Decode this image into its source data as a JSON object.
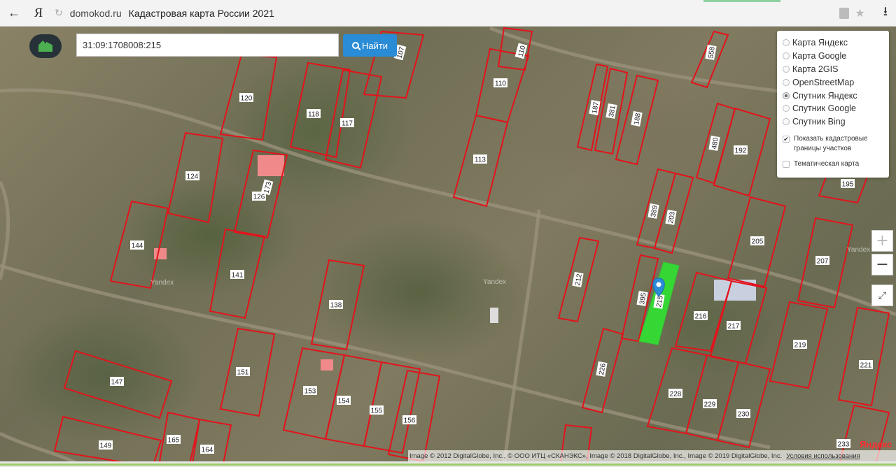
{
  "browser": {
    "back_icon": "←",
    "yandex_logo": "Я",
    "domain": "domokod.ru",
    "title": "Кадастровая карта России 2021",
    "download_icon": "⭳",
    "star_icon": "★"
  },
  "search": {
    "value": "31:09:1708008:215",
    "button_label": "Найти"
  },
  "layers": {
    "options": [
      {
        "label": "Карта Яндекс",
        "selected": false
      },
      {
        "label": "Карта Google",
        "selected": false
      },
      {
        "label": "Карта 2GIS",
        "selected": false
      },
      {
        "label": "OpenStreetMap",
        "selected": false
      },
      {
        "label": "Спутник Яндекс",
        "selected": true
      },
      {
        "label": "Спутник Google",
        "selected": false
      },
      {
        "label": "Спутник Bing",
        "selected": false
      }
    ],
    "show_cadastral_label": "Показать кадастровые границы участков",
    "show_cadastral_checked": true,
    "thematic_label": "Тематическая карта",
    "thematic_checked": false
  },
  "zoom": {
    "in": "+",
    "out": "−",
    "fullscreen": "⤢"
  },
  "map": {
    "watermarks": [
      "Yandex",
      "Yandex",
      "Yandex"
    ],
    "parcels": [
      "120",
      "107",
      "118",
      "117",
      "110",
      "110",
      "113",
      "124",
      "126",
      "173",
      "144",
      "141",
      "138",
      "147",
      "151",
      "153",
      "154",
      "155",
      "156",
      "149",
      "165",
      "164",
      "187",
      "381",
      "188",
      "480",
      "192",
      "195",
      "389",
      "203",
      "205",
      "207",
      "212",
      "395",
      "215",
      "216",
      "217",
      "219",
      "221",
      "226",
      "228",
      "229",
      "230",
      "233",
      "558"
    ],
    "selected_parcel": "215"
  },
  "attribution": {
    "text": "Image © 2012 DigitalGlobe, Inc., © ООО ИТЦ «СКАНЭКС», Image © 2018 DigitalGlobe, Inc., Image © 2019 DigitalGlobe, Inc.",
    "terms": "Условия использования",
    "yandex": "Яндекс"
  },
  "colors": {
    "parcel_border": "#e3131b",
    "selected_parcel": "#33dd33",
    "search_button": "#2a8bd6",
    "marker": "#2a8bd6"
  }
}
